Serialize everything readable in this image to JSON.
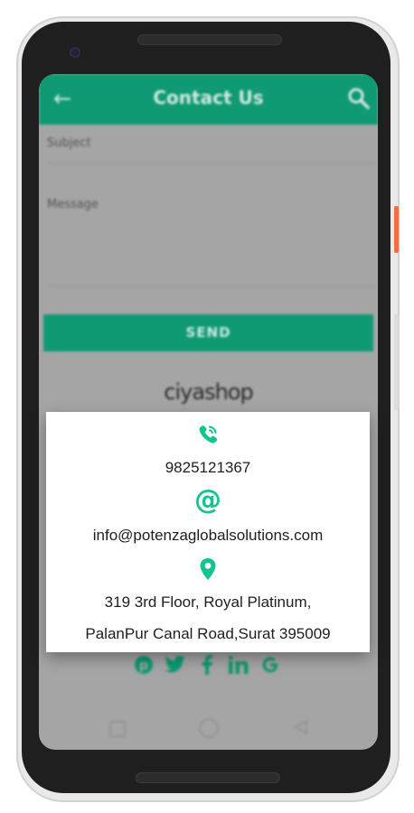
{
  "app": {
    "header": {
      "title": "Contact Us",
      "back_icon": "arrow-left-icon",
      "search_icon": "search-icon"
    },
    "form": {
      "subject_label": "Subject",
      "message_label": "Message",
      "send_label": "SEND"
    },
    "brand": {
      "name": "ciyashop"
    },
    "social": [
      "pinterest-icon",
      "twitter-icon",
      "facebook-icon",
      "linkedin-icon",
      "google-icon"
    ],
    "colors": {
      "primary": "#0f9a73",
      "accent": "#12c58f",
      "overlay": "#a5a5a5"
    }
  },
  "dialog": {
    "phone_icon": "phone-icon",
    "phone": "9825121367",
    "email_icon": "at-icon",
    "email_symbol": "@",
    "email": "info@potenzaglobalsolutions.com",
    "location_icon": "map-pin-icon",
    "address_line1": "319 3rd Floor, Royal Platinum,",
    "address_line2": "PalanPur Canal Road,Surat 395009"
  }
}
